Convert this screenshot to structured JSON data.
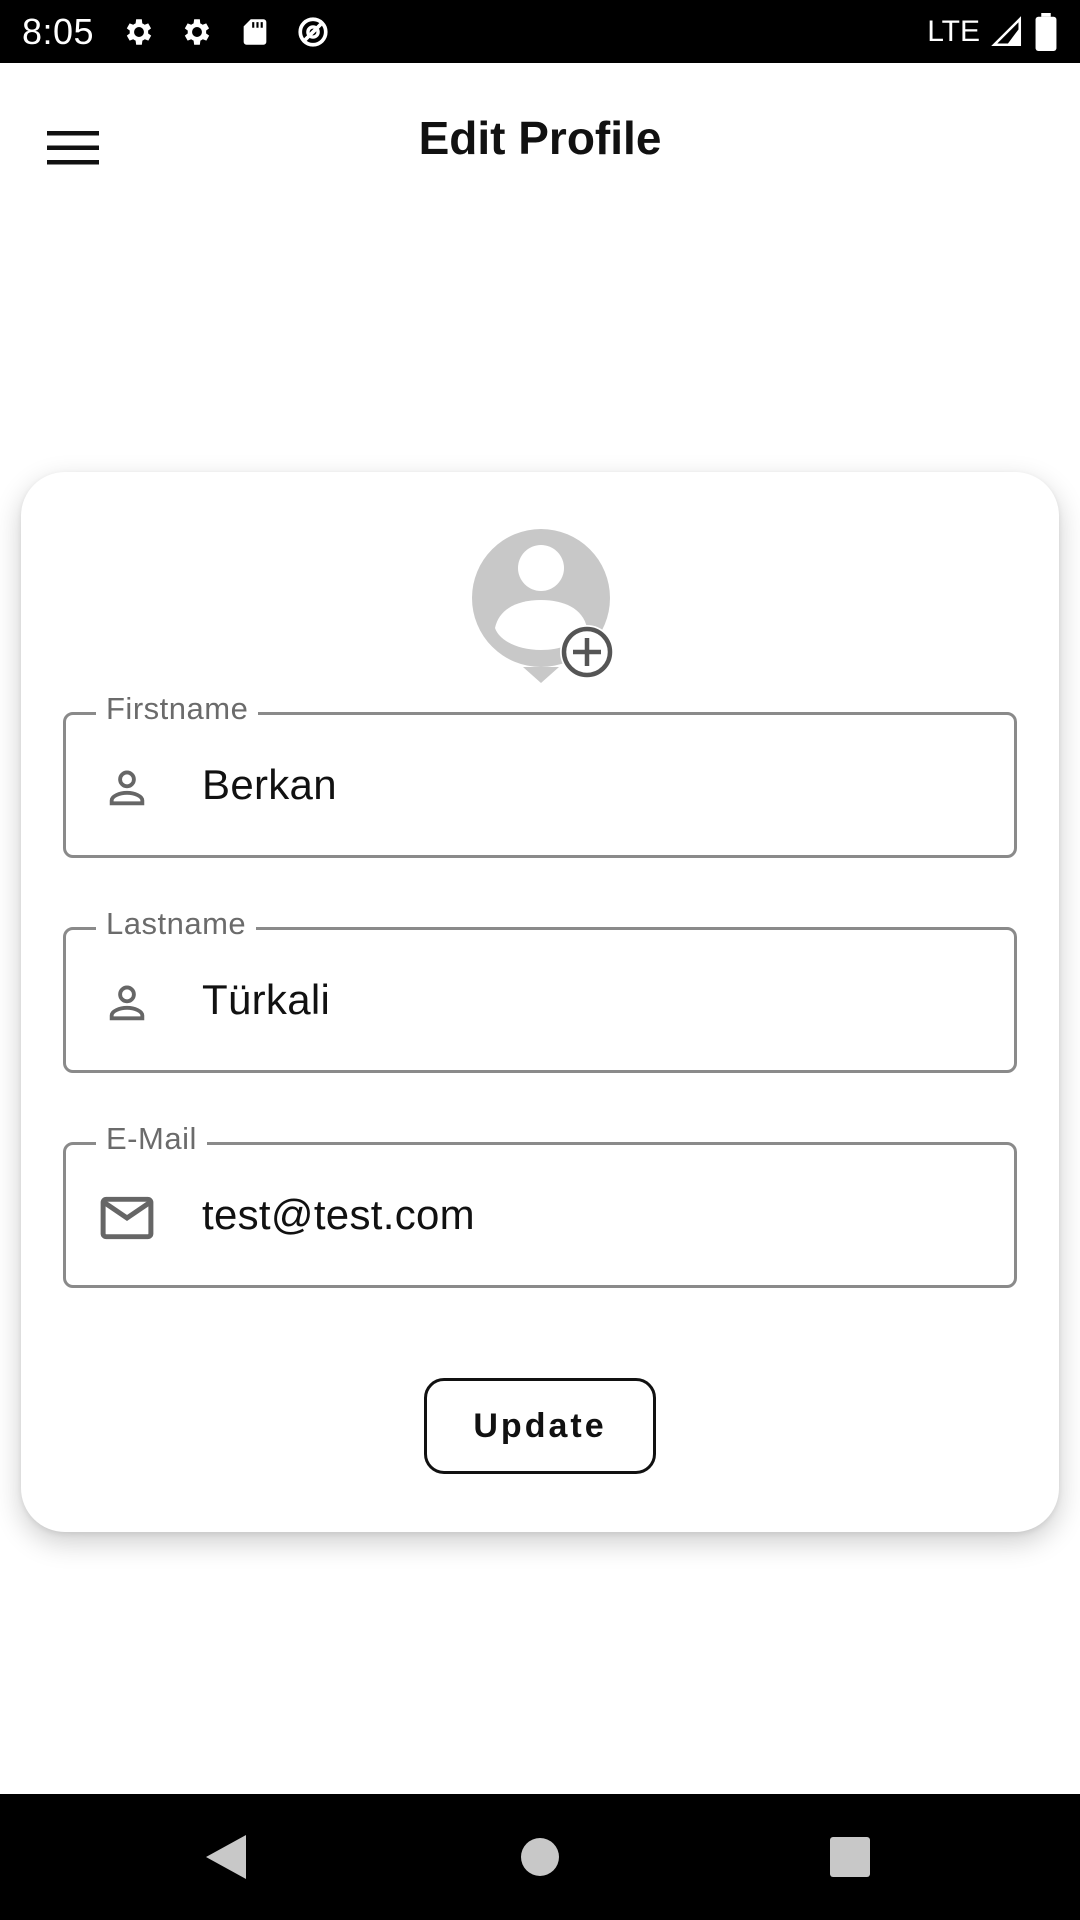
{
  "status_bar": {
    "time": "8:05",
    "left_icons": [
      "settings-icon",
      "settings-icon",
      "sd-card-icon",
      "no-access-icon"
    ],
    "network": "LTE",
    "right_icons": [
      "signal-icon",
      "battery-icon"
    ]
  },
  "app_bar": {
    "title": "Edit Profile",
    "menu_icon": "menu-icon"
  },
  "profile": {
    "avatar_icon": "account-circle-icon",
    "add_photo_icon": "add-circle-icon"
  },
  "form": {
    "firstname": {
      "label": "Firstname",
      "value": "Berkan",
      "icon": "person-icon"
    },
    "lastname": {
      "label": "Lastname",
      "value": "Türkali",
      "icon": "person-icon"
    },
    "email": {
      "label": "E-Mail",
      "value": "test@test.com",
      "icon": "mail-icon"
    },
    "update_label": "Update"
  },
  "nav_bar": {
    "buttons": [
      "back-icon",
      "home-icon",
      "recents-icon"
    ]
  },
  "colors": {
    "field_border": "#8a8a8a",
    "label_text": "#6b6b6b",
    "avatar": "#c8c8c8",
    "bars": "#000000"
  }
}
